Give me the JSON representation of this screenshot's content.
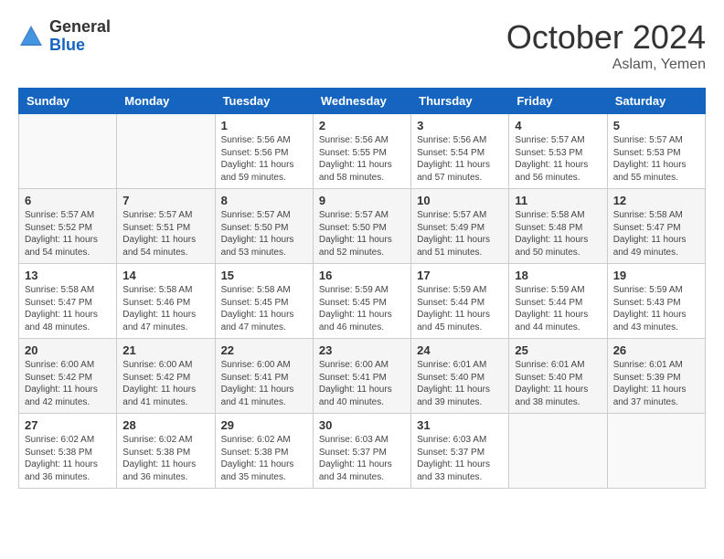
{
  "header": {
    "logo": {
      "general": "General",
      "blue": "Blue"
    },
    "title": "October 2024",
    "location": "Aslam, Yemen"
  },
  "calendar": {
    "days_of_week": [
      "Sunday",
      "Monday",
      "Tuesday",
      "Wednesday",
      "Thursday",
      "Friday",
      "Saturday"
    ],
    "rows": [
      [
        {
          "day": "",
          "info": ""
        },
        {
          "day": "",
          "info": ""
        },
        {
          "day": "1",
          "info": "Sunrise: 5:56 AM\nSunset: 5:56 PM\nDaylight: 11 hours and 59 minutes."
        },
        {
          "day": "2",
          "info": "Sunrise: 5:56 AM\nSunset: 5:55 PM\nDaylight: 11 hours and 58 minutes."
        },
        {
          "day": "3",
          "info": "Sunrise: 5:56 AM\nSunset: 5:54 PM\nDaylight: 11 hours and 57 minutes."
        },
        {
          "day": "4",
          "info": "Sunrise: 5:57 AM\nSunset: 5:53 PM\nDaylight: 11 hours and 56 minutes."
        },
        {
          "day": "5",
          "info": "Sunrise: 5:57 AM\nSunset: 5:53 PM\nDaylight: 11 hours and 55 minutes."
        }
      ],
      [
        {
          "day": "6",
          "info": "Sunrise: 5:57 AM\nSunset: 5:52 PM\nDaylight: 11 hours and 54 minutes."
        },
        {
          "day": "7",
          "info": "Sunrise: 5:57 AM\nSunset: 5:51 PM\nDaylight: 11 hours and 54 minutes."
        },
        {
          "day": "8",
          "info": "Sunrise: 5:57 AM\nSunset: 5:50 PM\nDaylight: 11 hours and 53 minutes."
        },
        {
          "day": "9",
          "info": "Sunrise: 5:57 AM\nSunset: 5:50 PM\nDaylight: 11 hours and 52 minutes."
        },
        {
          "day": "10",
          "info": "Sunrise: 5:57 AM\nSunset: 5:49 PM\nDaylight: 11 hours and 51 minutes."
        },
        {
          "day": "11",
          "info": "Sunrise: 5:58 AM\nSunset: 5:48 PM\nDaylight: 11 hours and 50 minutes."
        },
        {
          "day": "12",
          "info": "Sunrise: 5:58 AM\nSunset: 5:47 PM\nDaylight: 11 hours and 49 minutes."
        }
      ],
      [
        {
          "day": "13",
          "info": "Sunrise: 5:58 AM\nSunset: 5:47 PM\nDaylight: 11 hours and 48 minutes."
        },
        {
          "day": "14",
          "info": "Sunrise: 5:58 AM\nSunset: 5:46 PM\nDaylight: 11 hours and 47 minutes."
        },
        {
          "day": "15",
          "info": "Sunrise: 5:58 AM\nSunset: 5:45 PM\nDaylight: 11 hours and 47 minutes."
        },
        {
          "day": "16",
          "info": "Sunrise: 5:59 AM\nSunset: 5:45 PM\nDaylight: 11 hours and 46 minutes."
        },
        {
          "day": "17",
          "info": "Sunrise: 5:59 AM\nSunset: 5:44 PM\nDaylight: 11 hours and 45 minutes."
        },
        {
          "day": "18",
          "info": "Sunrise: 5:59 AM\nSunset: 5:44 PM\nDaylight: 11 hours and 44 minutes."
        },
        {
          "day": "19",
          "info": "Sunrise: 5:59 AM\nSunset: 5:43 PM\nDaylight: 11 hours and 43 minutes."
        }
      ],
      [
        {
          "day": "20",
          "info": "Sunrise: 6:00 AM\nSunset: 5:42 PM\nDaylight: 11 hours and 42 minutes."
        },
        {
          "day": "21",
          "info": "Sunrise: 6:00 AM\nSunset: 5:42 PM\nDaylight: 11 hours and 41 minutes."
        },
        {
          "day": "22",
          "info": "Sunrise: 6:00 AM\nSunset: 5:41 PM\nDaylight: 11 hours and 41 minutes."
        },
        {
          "day": "23",
          "info": "Sunrise: 6:00 AM\nSunset: 5:41 PM\nDaylight: 11 hours and 40 minutes."
        },
        {
          "day": "24",
          "info": "Sunrise: 6:01 AM\nSunset: 5:40 PM\nDaylight: 11 hours and 39 minutes."
        },
        {
          "day": "25",
          "info": "Sunrise: 6:01 AM\nSunset: 5:40 PM\nDaylight: 11 hours and 38 minutes."
        },
        {
          "day": "26",
          "info": "Sunrise: 6:01 AM\nSunset: 5:39 PM\nDaylight: 11 hours and 37 minutes."
        }
      ],
      [
        {
          "day": "27",
          "info": "Sunrise: 6:02 AM\nSunset: 5:38 PM\nDaylight: 11 hours and 36 minutes."
        },
        {
          "day": "28",
          "info": "Sunrise: 6:02 AM\nSunset: 5:38 PM\nDaylight: 11 hours and 36 minutes."
        },
        {
          "day": "29",
          "info": "Sunrise: 6:02 AM\nSunset: 5:38 PM\nDaylight: 11 hours and 35 minutes."
        },
        {
          "day": "30",
          "info": "Sunrise: 6:03 AM\nSunset: 5:37 PM\nDaylight: 11 hours and 34 minutes."
        },
        {
          "day": "31",
          "info": "Sunrise: 6:03 AM\nSunset: 5:37 PM\nDaylight: 11 hours and 33 minutes."
        },
        {
          "day": "",
          "info": ""
        },
        {
          "day": "",
          "info": ""
        }
      ]
    ]
  }
}
